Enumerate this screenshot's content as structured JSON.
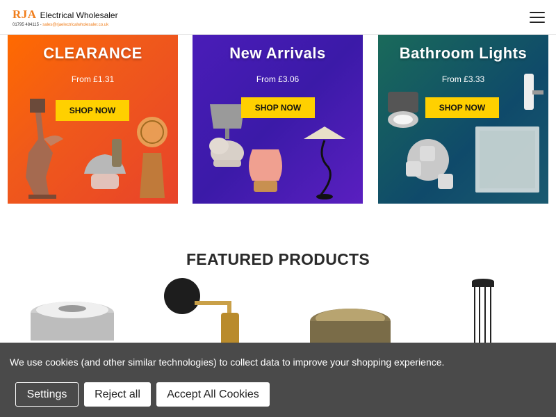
{
  "header": {
    "logo_mark": "RJA",
    "logo_name": "Electrical Wholesaler",
    "phone": "01795 484115 -",
    "email": "sales@rjaelectricalwholesaler.co.uk"
  },
  "banners": [
    {
      "title": "CLEARANCE",
      "subtitle": "From £1.31",
      "cta": "SHOP NOW"
    },
    {
      "title": "New Arrivals",
      "subtitle": "From £3.06",
      "cta": "SHOP NOW"
    },
    {
      "title": "Bathroom Lights",
      "subtitle": "From £3.33",
      "cta": "SHOP NOW"
    }
  ],
  "featured": {
    "title": "FEATURED PRODUCTS"
  },
  "cookie": {
    "message": "We use cookies (and other similar technologies) to collect data to improve your shopping experience.",
    "settings_label": "Settings",
    "reject_label": "Reject all",
    "accept_label": "Accept All Cookies"
  },
  "colors": {
    "brand_orange": "#f07d1a",
    "cta_yellow": "#ffd000",
    "cookie_bg": "#4a4a4a"
  }
}
